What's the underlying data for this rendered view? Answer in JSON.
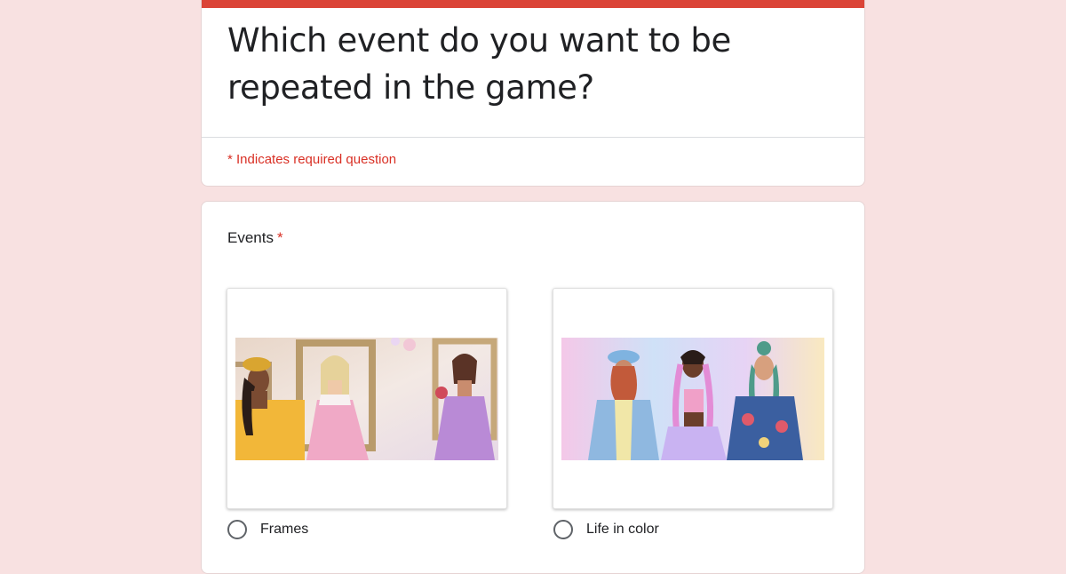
{
  "form": {
    "title": "Which event do you want to be repeated in the game?",
    "required_note": "* Indicates required question",
    "accent_color": "#db4437",
    "background_color": "#f8e1e1"
  },
  "question": {
    "title": "Events",
    "required_marker": "*",
    "options": [
      {
        "label": "Frames",
        "image": "frames-event-illustration"
      },
      {
        "label": "Life in color",
        "image": "life-in-color-event-illustration"
      }
    ]
  }
}
